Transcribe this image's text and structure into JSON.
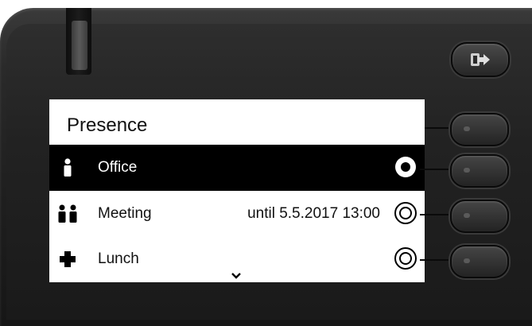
{
  "screen": {
    "title": "Presence",
    "items": [
      {
        "label": "Office",
        "detail": "",
        "icon": "single-person-icon",
        "selected": true
      },
      {
        "label": "Meeting",
        "detail": "until 5.5.2017 13:00",
        "icon": "two-persons-icon",
        "selected": false
      },
      {
        "label": "Lunch",
        "detail": "",
        "icon": "cross-icon",
        "selected": false
      }
    ]
  },
  "hardware": {
    "logout_key_icon": "logout-arrow-icon",
    "line_keys_count": 4
  },
  "colors": {
    "bezel": "#1f1f1f",
    "screen_background": "#ffffff",
    "selection_bar": "#000000",
    "text": "#111111"
  }
}
